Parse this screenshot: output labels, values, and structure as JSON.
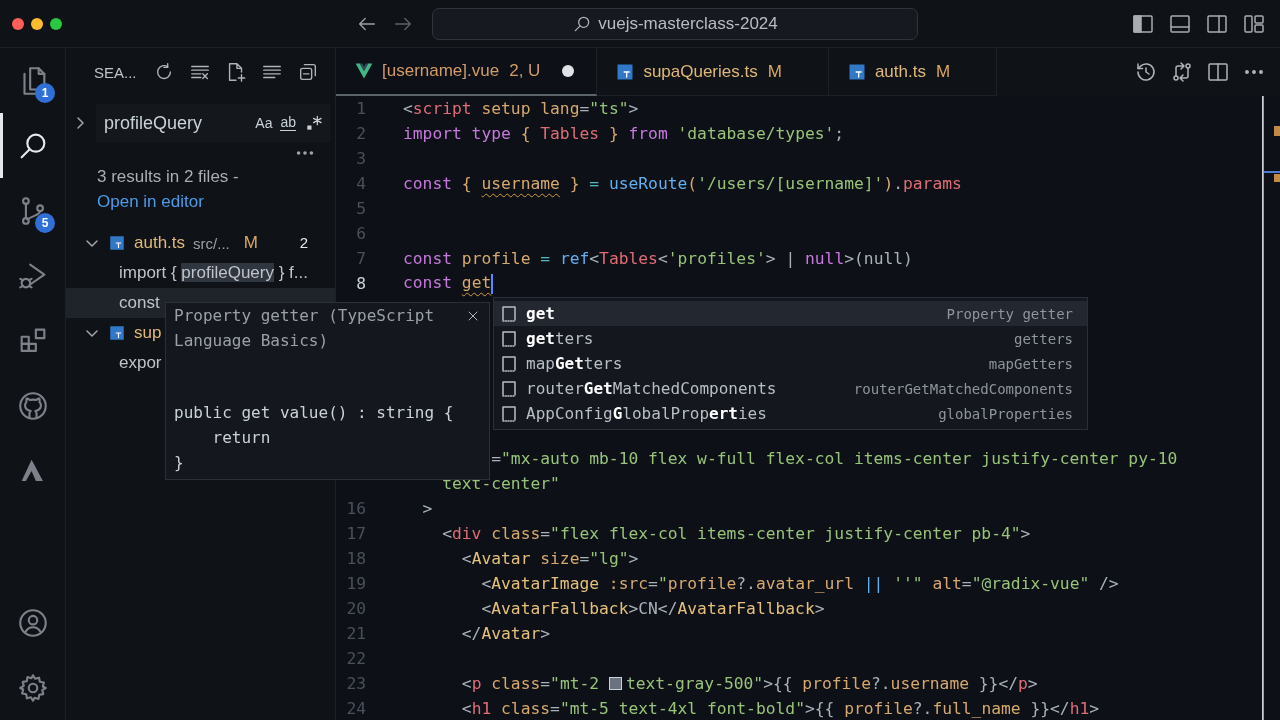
{
  "title_bar": {
    "command_center": "vuejs-masterclass-2024"
  },
  "activity_bar": {
    "items": [
      {
        "kind": "explorer",
        "selected": false,
        "badge": "1"
      },
      {
        "kind": "search",
        "selected": true
      },
      {
        "kind": "source-control",
        "selected": false,
        "badge": "5"
      },
      {
        "kind": "run",
        "selected": false
      },
      {
        "kind": "extensions",
        "selected": false
      },
      {
        "kind": "github",
        "selected": false
      },
      {
        "kind": "mountain",
        "selected": false
      }
    ],
    "bottom": [
      {
        "kind": "account"
      },
      {
        "kind": "settings"
      }
    ]
  },
  "sidebar": {
    "title": "SEA...",
    "search": {
      "replace_expanded": false,
      "value": "profileQuery",
      "options": [
        "Aa",
        "ab"
      ]
    },
    "summary": "3 results in 2 files -",
    "open_link": "Open in editor",
    "results": [
      {
        "file": "auth.ts",
        "path": "src/...",
        "status": "M",
        "count": "2",
        "expanded": true,
        "matches": [
          {
            "before": "import { ",
            "match": "profileQuery",
            "after": " } f...",
            "selected": false
          },
          {
            "before": "const",
            "selected": true
          }
        ]
      },
      {
        "file": "sup",
        "expanded": true,
        "matches": [
          {
            "before": "expor",
            "selected": false
          }
        ]
      }
    ]
  },
  "tabs": [
    {
      "kind": "vue",
      "label": "[username].vue",
      "status": "2, U",
      "dirty": true,
      "selected": true
    },
    {
      "kind": "ts",
      "label": "supaQueries.ts",
      "status": "M",
      "dirty": false,
      "selected": false
    },
    {
      "kind": "ts",
      "label": "auth.ts",
      "status": "M",
      "dirty": false,
      "selected": false
    }
  ],
  "code": {
    "above": [
      {
        "number": "1",
        "tokens": [
          {
            "kind": "punct",
            "text": "<"
          },
          {
            "kind": "tag",
            "text": "script"
          },
          {
            "kind": "attr",
            "text": " setup lang"
          },
          {
            "kind": "punct",
            "text": "="
          },
          {
            "kind": "str",
            "text": "\"ts\""
          },
          {
            "kind": "punct",
            "text": ">"
          }
        ]
      },
      {
        "number": "2",
        "tokens": [
          {
            "kind": "kw",
            "text": "import type "
          },
          {
            "kind": "brace",
            "text": "{ "
          },
          {
            "kind": "type",
            "text": "Tables"
          },
          {
            "kind": "brace",
            "text": " }"
          },
          {
            "kind": "kw",
            "text": " from "
          },
          {
            "kind": "str",
            "text": "'database/types'"
          },
          {
            "kind": "punct",
            "text": ";"
          }
        ]
      },
      {
        "number": "3"
      },
      {
        "number": "4",
        "tokens": [
          {
            "kind": "kw",
            "text": "const "
          },
          {
            "kind": "brace",
            "text": "{ "
          },
          {
            "kind": "var",
            "text": "username",
            "squiggle": true
          },
          {
            "kind": "brace",
            "text": " }"
          },
          {
            "kind": "op",
            "text": " = "
          },
          {
            "kind": "fn",
            "text": "useRoute"
          },
          {
            "kind": "brace",
            "text": "("
          },
          {
            "kind": "str",
            "text": "'/users/[username]'"
          },
          {
            "kind": "brace",
            "text": ")"
          },
          {
            "kind": "punct",
            "text": "."
          },
          {
            "kind": "prop",
            "text": "params"
          }
        ]
      },
      {
        "number": "5"
      },
      {
        "number": "6"
      },
      {
        "number": "7",
        "tokens": [
          {
            "kind": "kw",
            "text": "const "
          },
          {
            "kind": "var",
            "text": "profile"
          },
          {
            "kind": "op",
            "text": " = "
          },
          {
            "kind": "fn",
            "text": "ref"
          },
          {
            "kind": "punct",
            "text": "<"
          },
          {
            "kind": "type",
            "text": "Tables"
          },
          {
            "kind": "punct",
            "text": "<"
          },
          {
            "kind": "str",
            "text": "'profiles'"
          },
          {
            "kind": "punct",
            "text": "> | "
          },
          {
            "kind": "kw",
            "text": "null"
          },
          {
            "kind": "punct",
            "text": ">(null)"
          }
        ]
      },
      {
        "number": "8",
        "current": true,
        "tokens": [
          {
            "kind": "kw",
            "text": "const "
          },
          {
            "kind": "var",
            "text": "get",
            "squiggle": true,
            "cursor": true
          }
        ]
      }
    ],
    "below": [
      {
        "tokens": [
          {
            "kind": "punct",
            "text": "         ="
          },
          {
            "kind": "str",
            "text": "\"mx-auto mb-10 flex w-full flex-col items-center justify-center py-10"
          }
        ]
      },
      {
        "tokens": [
          {
            "kind": "str",
            "text": "    text-center\""
          }
        ]
      },
      {
        "number": "16",
        "tokens": [
          {
            "kind": "punct",
            "text": "  >"
          }
        ]
      },
      {
        "number": "17",
        "tokens": [
          {
            "kind": "punct",
            "text": "    <"
          },
          {
            "kind": "tag",
            "text": "div"
          },
          {
            "kind": "attr",
            "text": " class"
          },
          {
            "kind": "punct",
            "text": "="
          },
          {
            "kind": "str",
            "text": "\"flex flex-col items-center justify-center pb-4\""
          },
          {
            "kind": "punct",
            "text": ">"
          }
        ]
      },
      {
        "number": "18",
        "tokens": [
          {
            "kind": "punct",
            "text": "      <"
          },
          {
            "kind": "comp",
            "text": "Avatar"
          },
          {
            "kind": "attr",
            "text": " size"
          },
          {
            "kind": "punct",
            "text": "="
          },
          {
            "kind": "str",
            "text": "\"lg\""
          },
          {
            "kind": "punct",
            "text": ">"
          }
        ]
      },
      {
        "number": "19",
        "tokens": [
          {
            "kind": "punct",
            "text": "        <"
          },
          {
            "kind": "comp",
            "text": "AvatarImage"
          },
          {
            "kind": "attr",
            "text": " :src"
          },
          {
            "kind": "punct",
            "text": "="
          },
          {
            "kind": "str",
            "text": "\""
          },
          {
            "kind": "var",
            "text": "profile"
          },
          {
            "kind": "punct",
            "text": "?."
          },
          {
            "kind": "var",
            "text": "avatar_url"
          },
          {
            "kind": "fn",
            "text": " ||"
          },
          {
            "kind": "str",
            "text": " ''\""
          },
          {
            "kind": "attr",
            "text": " alt"
          },
          {
            "kind": "punct",
            "text": "="
          },
          {
            "kind": "str",
            "text": "\"@radix-vue\""
          },
          {
            "kind": "punct",
            "text": " />"
          }
        ]
      },
      {
        "number": "20",
        "tokens": [
          {
            "kind": "punct",
            "text": "        <"
          },
          {
            "kind": "comp",
            "text": "AvatarFallback"
          },
          {
            "kind": "punct",
            "text": ">CN</"
          },
          {
            "kind": "comp",
            "text": "AvatarFallback"
          },
          {
            "kind": "punct",
            "text": ">"
          }
        ]
      },
      {
        "number": "21",
        "tokens": [
          {
            "kind": "punct",
            "text": "      </"
          },
          {
            "kind": "comp",
            "text": "Avatar"
          },
          {
            "kind": "punct",
            "text": ">"
          }
        ]
      },
      {
        "number": "22"
      },
      {
        "number": "23",
        "tokens": [
          {
            "kind": "punct",
            "text": "      <"
          },
          {
            "kind": "tag",
            "text": "p"
          },
          {
            "kind": "attr",
            "text": " class"
          },
          {
            "kind": "punct",
            "text": "="
          },
          {
            "kind": "str",
            "text": "\"mt-2 "
          },
          {
            "kind": "swatch",
            "color": "#6b7280"
          },
          {
            "kind": "str",
            "text": "text-gray-500\""
          },
          {
            "kind": "punct",
            "text": ">{{ "
          },
          {
            "kind": "var",
            "text": "profile"
          },
          {
            "kind": "punct",
            "text": "?."
          },
          {
            "kind": "var",
            "text": "username"
          },
          {
            "kind": "punct",
            "text": " }}</"
          },
          {
            "kind": "tag",
            "text": "p"
          },
          {
            "kind": "punct",
            "text": ">"
          }
        ]
      },
      {
        "number": "24",
        "tokens": [
          {
            "kind": "punct",
            "text": "      <"
          },
          {
            "kind": "tag",
            "text": "h1"
          },
          {
            "kind": "attr",
            "text": " class"
          },
          {
            "kind": "punct",
            "text": "="
          },
          {
            "kind": "str",
            "text": "\"mt-5 text-4xl font-bold\""
          },
          {
            "kind": "punct",
            "text": ">{{ "
          },
          {
            "kind": "var",
            "text": "profile"
          },
          {
            "kind": "punct",
            "text": "?."
          },
          {
            "kind": "var",
            "text": "full_name"
          },
          {
            "kind": "punct",
            "text": " }}</"
          },
          {
            "kind": "tag",
            "text": "h1"
          },
          {
            "kind": "punct",
            "text": ">"
          }
        ]
      }
    ]
  },
  "suggestions": [
    {
      "label": "**get**",
      "detail": "Property getter",
      "selected": true
    },
    {
      "label": "**get**ters",
      "detail": "getters",
      "selected": false
    },
    {
      "label": "map**Get**ters",
      "detail": "mapGetters",
      "selected": false
    },
    {
      "label": "router**Get**MatchedComponents",
      "detail": "routerGetMatchedComponents",
      "selected": false
    },
    {
      "label": "AppConfig**G**lobalProp**ert**ies",
      "detail": "globalProperties",
      "selected": false
    }
  ],
  "hover": {
    "title": "Property getter (TypeScript Language Basics)",
    "code": [
      "public get value() : string {",
      "    return",
      "}"
    ]
  }
}
